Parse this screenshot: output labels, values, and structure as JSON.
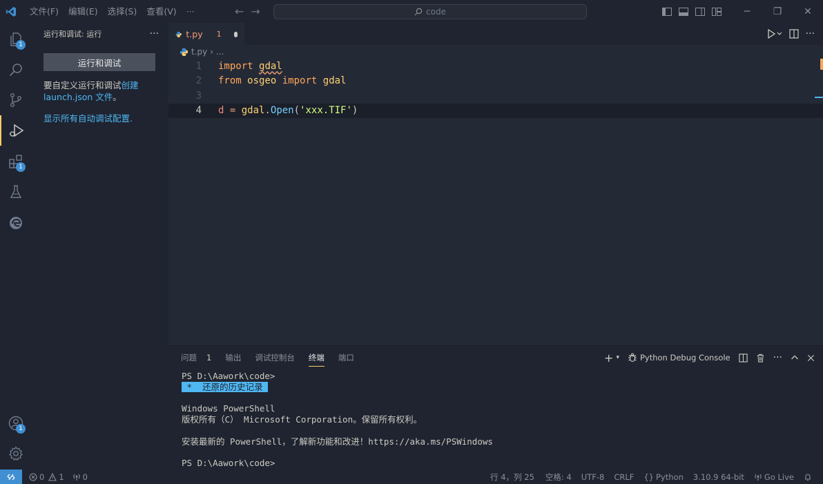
{
  "titlebar": {
    "menu": [
      "文件(F)",
      "编辑(E)",
      "选择(S)",
      "查看(V)",
      "···"
    ],
    "search_text": "code"
  },
  "activity": {
    "explorer_badge": "1",
    "extensions_badge": "1",
    "accounts_badge": "1"
  },
  "sidebar": {
    "title": "运行和调试: 运行",
    "more": "···",
    "run_button": "运行和调试",
    "text_prefix": "要自定义运行和调试",
    "text_link": "创建 launch.json 文件",
    "text_suffix": "。",
    "show_all_link": "显示所有自动调试配置."
  },
  "editor": {
    "tab": {
      "label": "t.py",
      "problems": "1"
    },
    "breadcrumb": {
      "file": "t.py",
      "rest": "..."
    },
    "lines": [
      {
        "n": "1"
      },
      {
        "n": "2"
      },
      {
        "n": "3"
      },
      {
        "n": "4"
      }
    ],
    "code": {
      "l1_kw": "import",
      "l1_mod": "gdal",
      "l2_kw": "from",
      "l2_pkg": "osgeo",
      "l2_kw2": "import",
      "l2_mod": "gdal",
      "l4_var": "d",
      "l4_eq": " = ",
      "l4_obj": "gdal",
      "l4_dot": ".",
      "l4_fn": "Open",
      "l4_open": "(",
      "l4_str": "'xxx.TIF'",
      "l4_close": ")"
    }
  },
  "panel": {
    "tabs": {
      "problems": "问题",
      "problems_count": "1",
      "output": "输出",
      "debug_console": "调试控制台",
      "terminal": "终端",
      "ports": "端口"
    },
    "terminal_name": "Python Debug Console",
    "terminal_lines": {
      "l1": "PS D:\\Aawork\\code>",
      "l2": " *  还原的历史记录 ",
      "l3": "",
      "l4": "Windows PowerShell",
      "l5": "版权所有（C） Microsoft Corporation。保留所有权利。",
      "l6": "",
      "l7": "安装最新的 PowerShell，了解新功能和改进！https://aka.ms/PSWindows",
      "l8": "",
      "l9": "PS D:\\Aawork\\code>"
    }
  },
  "statusbar": {
    "errors": "0",
    "warnings": "1",
    "ports": "0",
    "position": "行 4，列 25",
    "spaces": "空格: 4",
    "encoding": "UTF-8",
    "eol": "CRLF",
    "language": "Python",
    "interpreter": "3.10.9 64-bit",
    "golive": "Go Live"
  },
  "colors": {
    "background": "#1f2430",
    "editor_bg": "#242936",
    "accent": "#ffcc66",
    "link": "#4fb7f2",
    "badge": "#3f8fd2"
  }
}
